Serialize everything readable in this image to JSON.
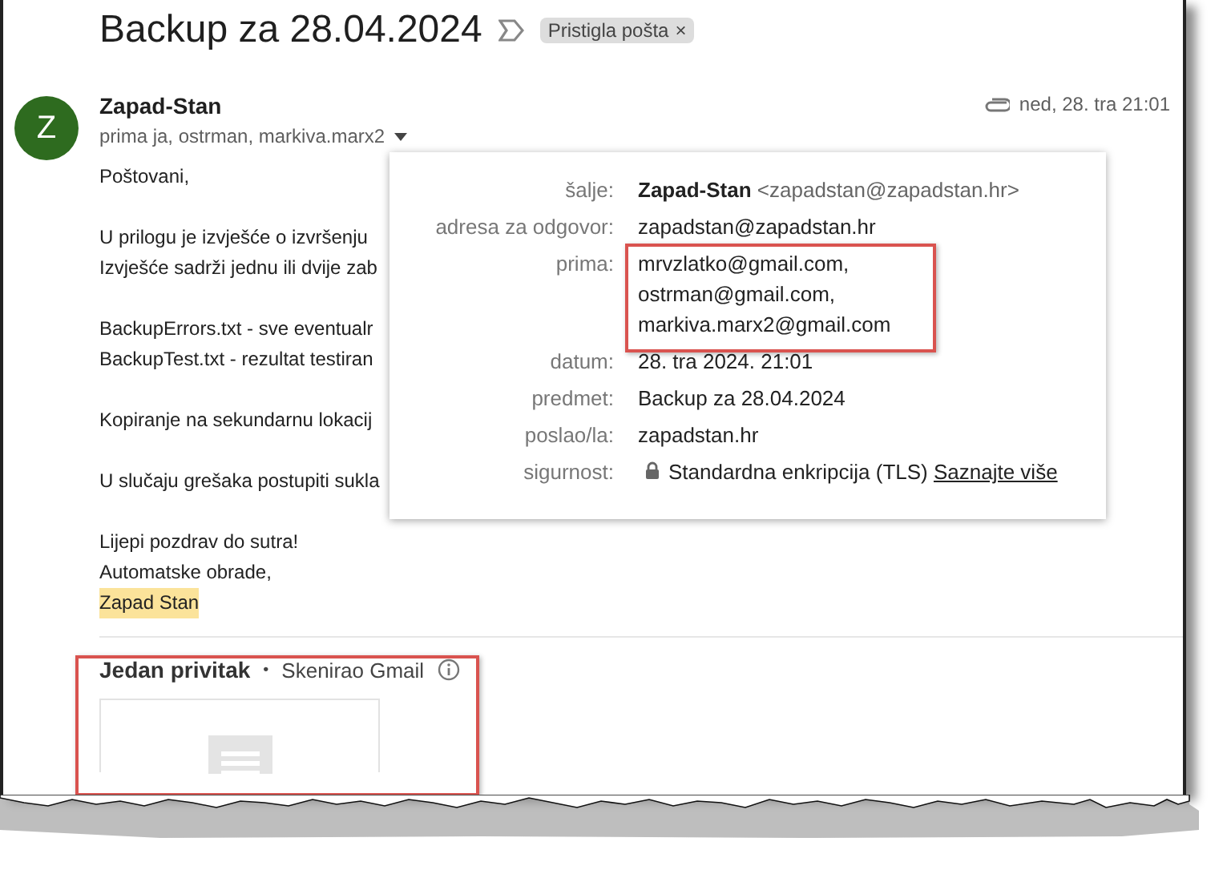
{
  "title": "Backup za 28.04.2024",
  "label_chip": {
    "text": "Pristigla pošta",
    "close": "×"
  },
  "message": {
    "avatar": "Z",
    "sender": "Zapad-Stan",
    "recipients": "prima ja, ostrman, markiva.marx2",
    "date": "ned, 28. tra 21:01",
    "body": [
      {
        "lines": [
          {
            "text": "Poštovani,",
            "highlighted": false
          }
        ]
      },
      {
        "lines": [
          {
            "text": "U prilogu je izvješće o izvršenju",
            "highlighted": false
          },
          {
            "text": "Izvješće sadrži jednu ili dvije zab",
            "highlighted": false
          }
        ]
      },
      {
        "lines": [
          {
            "text": "BackupErrors.txt - sve eventualr",
            "highlighted": false
          },
          {
            "text": "BackupTest.txt - rezultat testiran",
            "highlighted": false
          }
        ]
      },
      {
        "lines": [
          {
            "text": "Kopiranje na sekundarnu lokacij",
            "highlighted": false
          }
        ]
      },
      {
        "lines": [
          {
            "text": "U slučaju grešaka postupiti sukla",
            "highlighted": false
          }
        ]
      },
      {
        "lines": [
          {
            "text": "Lijepi pozdrav do sutra!",
            "highlighted": false
          },
          {
            "text": "Automatske obrade,",
            "highlighted": false
          },
          {
            "text": "Zapad Stan",
            "highlighted": true
          }
        ]
      }
    ]
  },
  "details": [
    {
      "kind": "sender",
      "label": "šalje:",
      "value": "Zapad-Stan",
      "extra": "<zapadstan@zapadstan.hr>"
    },
    {
      "kind": "text",
      "label": "adresa za odgovor:",
      "value": "zapadstan@zapadstan.hr"
    },
    {
      "kind": "list",
      "label": "prima:",
      "values": [
        "mrvzlatko@gmail.com,",
        "ostrman@gmail.com,",
        "markiva.marx2@gmail.com"
      ]
    },
    {
      "kind": "text",
      "label": "datum:",
      "value": "28. tra 2024. 21:01"
    },
    {
      "kind": "text",
      "label": "predmet:",
      "value": "Backup za 28.04.2024"
    },
    {
      "kind": "text",
      "label": "poslao/la:",
      "value": "zapadstan.hr"
    },
    {
      "kind": "security",
      "label": "sigurnost:",
      "value": "Standardna enkripcija (TLS)",
      "link": "Saznajte više"
    }
  ],
  "attachments": {
    "heading": "Jedan privitak",
    "separator": "•",
    "scan_note": "Skenirao Gmail"
  }
}
